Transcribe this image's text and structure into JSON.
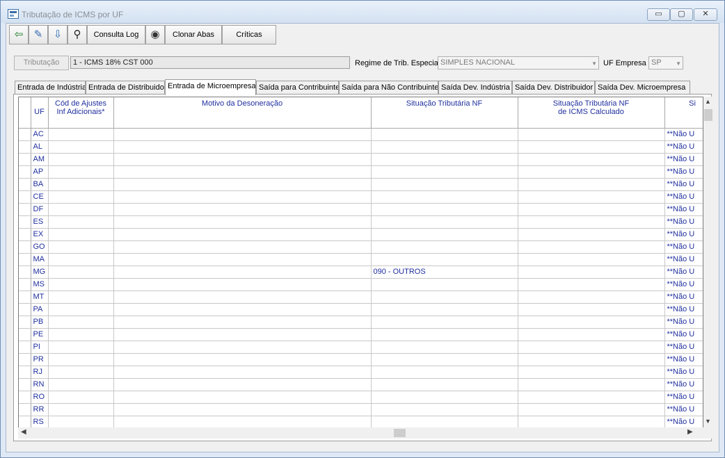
{
  "window": {
    "title": "Tributação de ICMS por UF",
    "controls": {
      "minimize": "▭",
      "maximize": "▢",
      "close": "✕"
    }
  },
  "toolbar": {
    "icons": [
      "exit-icon",
      "pencil-icon",
      "export-icon",
      "binoculars-icon",
      "camera-icon"
    ],
    "exit_glyph": "⇦",
    "edit_glyph": "✎",
    "export_glyph": "⇩",
    "find_glyph": "⚲",
    "camera_glyph": "◉",
    "consulta_log": "Consulta Log",
    "clonar_abas": "Clonar Abas",
    "criticas": "Críticas"
  },
  "form": {
    "tributacao_button": "Tributação",
    "tributacao_value": "1  -  ICMS 18% CST 000",
    "regime_label": "Regime de Trib. Especial",
    "regime_value": "SIMPLES NACIONAL",
    "uf_empresa_label": "UF Empresa",
    "uf_empresa_value": "SP"
  },
  "tabs": [
    {
      "label": "Entrada de Indústria",
      "active": false
    },
    {
      "label": "Entrada de Distribuidor",
      "active": false
    },
    {
      "label": "Entrada de Microempresa",
      "active": true
    },
    {
      "label": "Saída para Contribuinte",
      "active": false
    },
    {
      "label": "Saída para Não Contribuinte",
      "active": false
    },
    {
      "label": "Saída Dev. Indústria",
      "active": false
    },
    {
      "label": "Saída Dev. Distribuidor",
      "active": false
    },
    {
      "label": "Saída Dev. Microempresa",
      "active": false
    }
  ],
  "grid": {
    "columns": [
      "UF",
      "Cód de Ajustes\nInf Adicionais*",
      "Motivo da Desoneração",
      "Situação Tributária NF",
      "Situação Tributária NF\nde ICMS Calculado",
      "Si"
    ],
    "rows": [
      [
        "AC",
        "",
        "",
        "",
        "",
        "**Não U"
      ],
      [
        "AL",
        "",
        "",
        "",
        "",
        "**Não U"
      ],
      [
        "AM",
        "",
        "",
        "",
        "",
        "**Não U"
      ],
      [
        "AP",
        "",
        "",
        "",
        "",
        "**Não U"
      ],
      [
        "BA",
        "",
        "",
        "",
        "",
        "**Não U"
      ],
      [
        "CE",
        "",
        "",
        "",
        "",
        "**Não U"
      ],
      [
        "DF",
        "",
        "",
        "",
        "",
        "**Não U"
      ],
      [
        "ES",
        "",
        "",
        "",
        "",
        "**Não U"
      ],
      [
        "EX",
        "",
        "",
        "",
        "",
        "**Não U"
      ],
      [
        "GO",
        "",
        "",
        "",
        "",
        "**Não U"
      ],
      [
        "MA",
        "",
        "",
        "",
        "",
        "**Não U"
      ],
      [
        "MG",
        "",
        "",
        "090 - OUTROS",
        "",
        "**Não U"
      ],
      [
        "MS",
        "",
        "",
        "",
        "",
        "**Não U"
      ],
      [
        "MT",
        "",
        "",
        "",
        "",
        "**Não U"
      ],
      [
        "PA",
        "",
        "",
        "",
        "",
        "**Não U"
      ],
      [
        "PB",
        "",
        "",
        "",
        "",
        "**Não U"
      ],
      [
        "PE",
        "",
        "",
        "",
        "",
        "**Não U"
      ],
      [
        "PI",
        "",
        "",
        "",
        "",
        "**Não U"
      ],
      [
        "PR",
        "",
        "",
        "",
        "",
        "**Não U"
      ],
      [
        "RJ",
        "",
        "",
        "",
        "",
        "**Não U"
      ],
      [
        "RN",
        "",
        "",
        "",
        "",
        "**Não U"
      ],
      [
        "RO",
        "",
        "",
        "",
        "",
        "**Não U"
      ],
      [
        "RR",
        "",
        "",
        "",
        "",
        "**Não U"
      ],
      [
        "RS",
        "",
        "",
        "",
        "",
        "**Não U"
      ]
    ]
  },
  "scrollbars": {
    "up": "▲",
    "down": "▼",
    "left": "◀",
    "right": "▶"
  },
  "colors": {
    "grid_text": "#1f2f9e",
    "title_text": "#8a8f96",
    "window_frame": "#dfe9f5"
  }
}
